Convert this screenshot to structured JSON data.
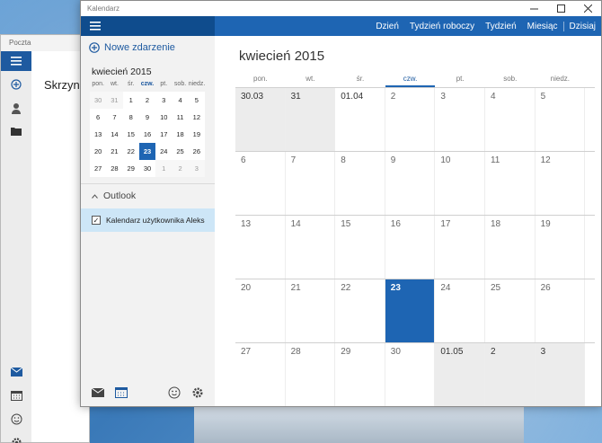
{
  "mail": {
    "title": "Poczta",
    "inbox_label": "Skrzynka"
  },
  "calendar_window": {
    "title": "Kalendarz"
  },
  "topbar": {
    "views": [
      "Dzień",
      "Tydzień roboczy",
      "Tydzień",
      "Miesiąc",
      "Dzisiaj"
    ]
  },
  "sidebar": {
    "new_event_label": "Nowe zdarzenie",
    "mini_title": "kwiecień 2015",
    "mini_dow": [
      "pon.",
      "wt.",
      "śr.",
      "czw.",
      "pt.",
      "sob.",
      "niedz."
    ],
    "mini_weeks": [
      [
        "30",
        "31",
        "1",
        "2",
        "3",
        "4",
        "5"
      ],
      [
        "6",
        "7",
        "8",
        "9",
        "10",
        "11",
        "12"
      ],
      [
        "13",
        "14",
        "15",
        "16",
        "17",
        "18",
        "19"
      ],
      [
        "20",
        "21",
        "22",
        "23",
        "24",
        "25",
        "26"
      ],
      [
        "27",
        "28",
        "29",
        "30",
        "1",
        "2",
        "3"
      ]
    ],
    "group_label": "Outlook",
    "calendar_item_label": "Kalendarz użytkownika Aleks",
    "calendar_item_checked": "✓"
  },
  "main": {
    "month_title": "kwiecień 2015",
    "dow": [
      "pon.",
      "wt.",
      "śr.",
      "czw.",
      "pt.",
      "sob.",
      "niedz."
    ],
    "weeks": [
      [
        "30.03",
        "31",
        "01.04",
        "2",
        "3",
        "4",
        "5"
      ],
      [
        "6",
        "7",
        "8",
        "9",
        "10",
        "11",
        "12"
      ],
      [
        "13",
        "14",
        "15",
        "16",
        "17",
        "18",
        "19"
      ],
      [
        "20",
        "21",
        "22",
        "23",
        "24",
        "25",
        "26"
      ],
      [
        "27",
        "28",
        "29",
        "30",
        "01.05",
        "2",
        "3"
      ]
    ]
  },
  "colors": {
    "accent": "#1e65b3",
    "accent_dark": "#0f4c8d",
    "selection": "#cde6f7"
  }
}
